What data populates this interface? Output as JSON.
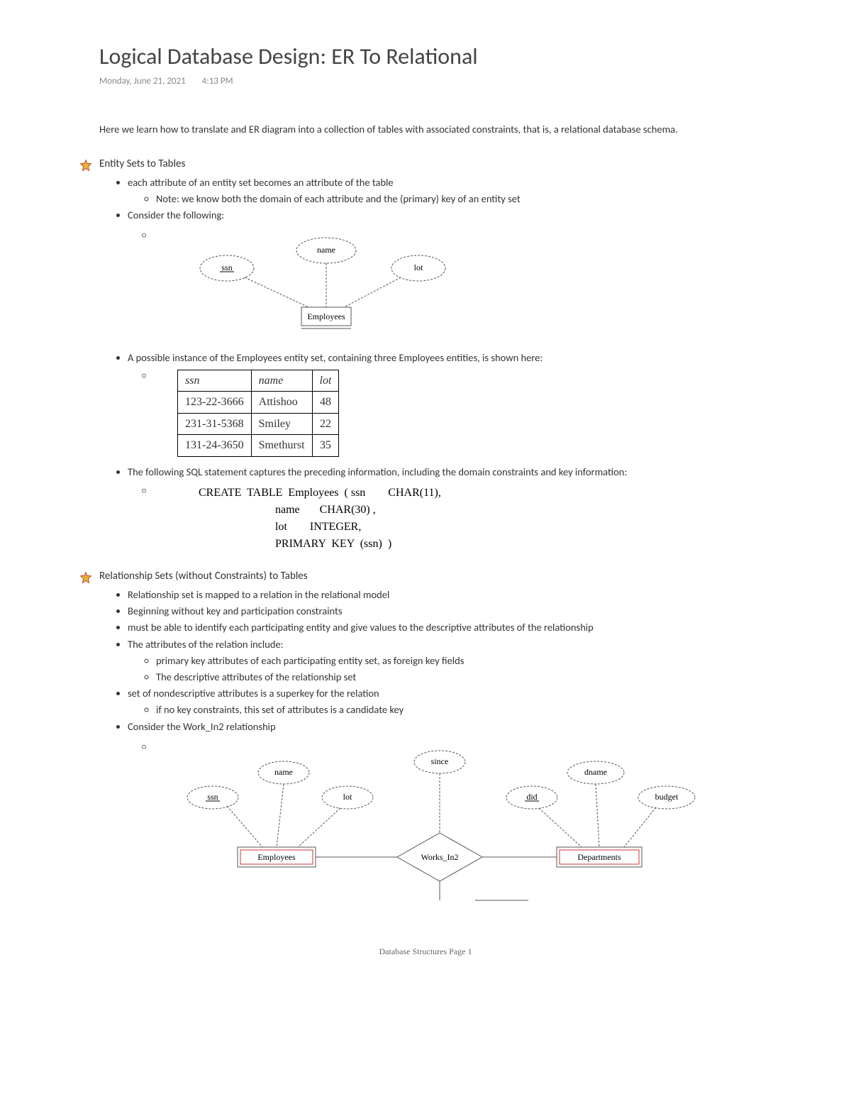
{
  "title": "Logical Database Design: ER To Relational",
  "date": "Monday, June 21, 2021",
  "time": "4:13 PM",
  "intro": "Here we learn how to translate and ER diagram into a collection of tables with associated constraints, that is, a relational database schema.",
  "section1": {
    "heading": "Entity Sets to Tables",
    "b1": "each attribute of an entity set becomes an attribute of the table",
    "b1_1": "Note: we know both the domain of each attribute and the (primary) key of an entity set",
    "b2": "Consider the following:",
    "b3": "A possible instance of the Employees entity set, containing three Employees entities, is shown here:",
    "b4": "The following SQL statement captures the preceding information, including the domain constraints and key information:"
  },
  "diagram1": {
    "attr1": "ssn",
    "attr2": "name",
    "attr3": "lot",
    "entity": "Employees"
  },
  "table": {
    "headers": {
      "c1": "ssn",
      "c2": "name",
      "c3": "lot"
    },
    "rows": [
      {
        "ssn": "123-22-3666",
        "name": "Attishoo",
        "lot": "48"
      },
      {
        "ssn": "231-31-5368",
        "name": "Smiley",
        "lot": "22"
      },
      {
        "ssn": "131-24-3650",
        "name": "Smethurst",
        "lot": "35"
      }
    ]
  },
  "sql": "CREATE  TABLE  Employees  ( ssn        CHAR(11),\n                           name       CHAR(30) ,\n                           lot        INTEGER,\n                           PRIMARY  KEY  (ssn)  )",
  "section2": {
    "heading": "Relationship Sets (without Constraints) to Tables",
    "b1": "Relationship set is mapped to a relation in the relational model",
    "b2": "Beginning without key and participation constraints",
    "b3": "must be able to identify each participating entity and give values to the descriptive attributes of the relationship",
    "b4": "The attributes of the relation include:",
    "b4_1": "primary key attributes of each participating entity set, as foreign key fields",
    "b4_2": "The descriptive attributes of the relationship set",
    "b5": "set of nondescriptive attributes is a superkey for the relation",
    "b5_1": "if no key constraints, this set of attributes is a candidate key",
    "b6": "Consider the Work_In2 relationship"
  },
  "diagram2": {
    "e1_a1": "ssn",
    "e1_a2": "name",
    "e1_a3": "lot",
    "e1": "Employees",
    "rel": "Works_In2",
    "rel_attr": "since",
    "e2_a1": "did",
    "e2_a2": "dname",
    "e2_a3": "budget",
    "e2": "Departments"
  },
  "footer": "Database Structures Page 1"
}
